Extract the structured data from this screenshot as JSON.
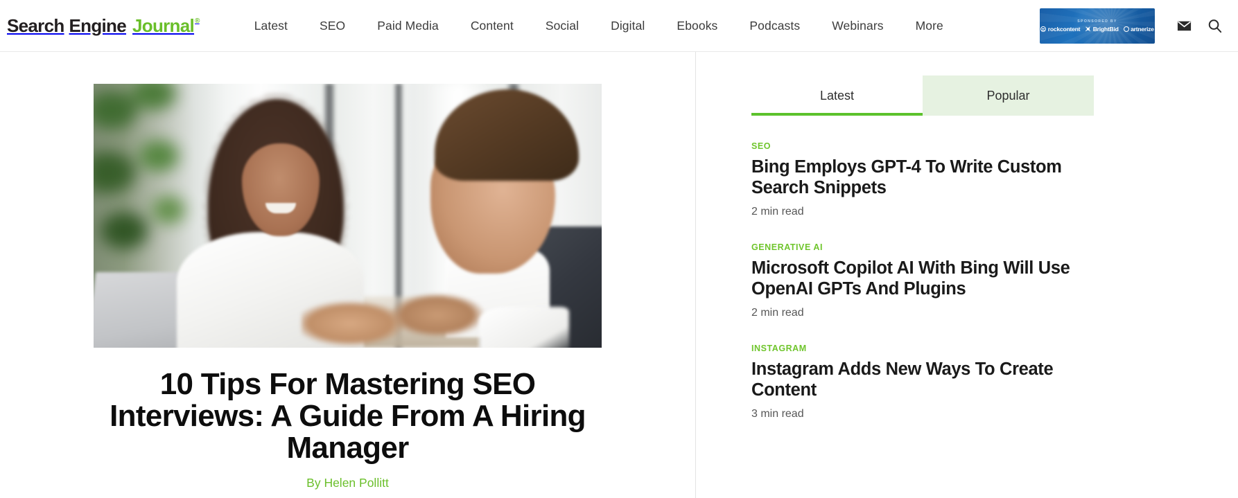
{
  "site": {
    "logo": {
      "part1": "Search",
      "part2": "Engine",
      "part3": "Journal",
      "trademark": "®"
    },
    "brand_green": "#6abf2a",
    "accent_green": "#5cc22c",
    "category_green": "#6fc52c"
  },
  "nav": {
    "items": [
      {
        "label": "Latest"
      },
      {
        "label": "SEO"
      },
      {
        "label": "Paid Media"
      },
      {
        "label": "Content"
      },
      {
        "label": "Social"
      },
      {
        "label": "Digital"
      },
      {
        "label": "Ebooks"
      },
      {
        "label": "Podcasts"
      },
      {
        "label": "Webinars"
      },
      {
        "label": "More"
      }
    ]
  },
  "sponsor": {
    "label": "SPONSORED BY",
    "logos": [
      {
        "name": "rockcontent"
      },
      {
        "name": "BrightBid"
      },
      {
        "name": "artnerize"
      }
    ]
  },
  "header_icons": {
    "newsletter": "envelope-icon",
    "search": "search-icon"
  },
  "hero": {
    "image_alt": "Two professionals shaking hands across a desk in a bright office",
    "title": "10 Tips For Mastering SEO Interviews: A Guide From A Hiring Manager",
    "byline": "By Helen Pollitt"
  },
  "sidebar": {
    "tabs": [
      {
        "label": "Latest",
        "active": true
      },
      {
        "label": "Popular",
        "active": false
      }
    ],
    "articles": [
      {
        "category": "SEO",
        "title": "Bing Employs GPT-4 To Write Custom Search Snippets",
        "read_time": "2 min read"
      },
      {
        "category": "GENERATIVE AI",
        "title": "Microsoft Copilot AI With Bing Will Use OpenAI GPTs And Plugins",
        "read_time": "2 min read"
      },
      {
        "category": "INSTAGRAM",
        "title": "Instagram Adds New Ways To Create Content",
        "read_time": "3 min read"
      }
    ]
  }
}
